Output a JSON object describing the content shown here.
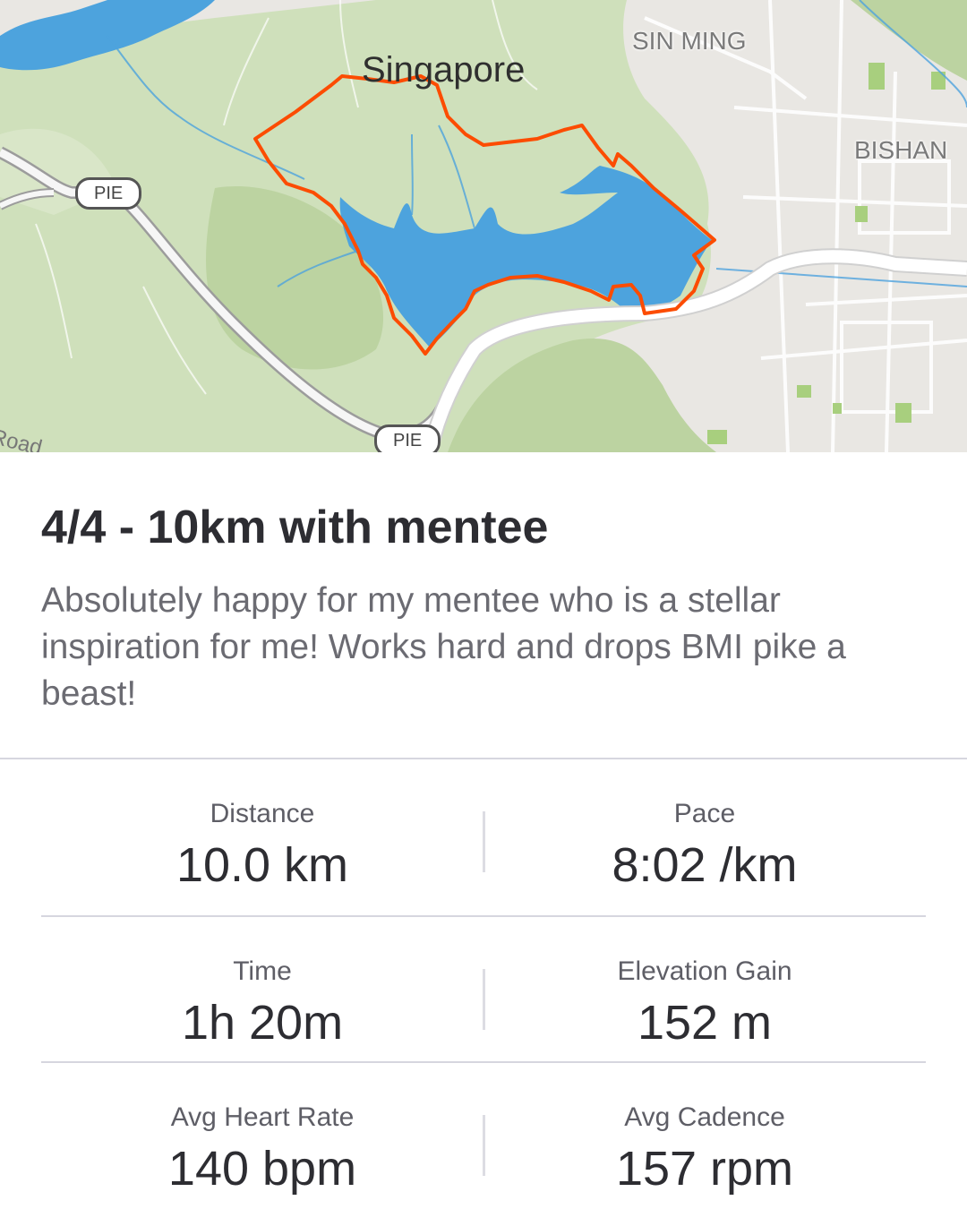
{
  "map": {
    "city_label": "Singapore",
    "area_labels": [
      "SIN MING",
      "BISHAN"
    ],
    "road_shields": [
      "PIE",
      "PIE"
    ],
    "road_label": "Road",
    "colors": {
      "route": "#fc4c02",
      "water": "#4da3dd",
      "park": "#c7dbb0",
      "land": "#e9e7e3",
      "road": "#ffffff",
      "highway_casing": "#9c9c9c"
    }
  },
  "activity": {
    "title": "4/4 - 10km with mentee",
    "description": "Absolutely happy for my mentee who is a stellar inspiration for me! Works hard and drops BMI pike a beast!"
  },
  "stats": [
    {
      "left": {
        "label": "Distance",
        "value": "10.0 km"
      },
      "right": {
        "label": "Pace",
        "value": "8:02 /km"
      }
    },
    {
      "left": {
        "label": "Time",
        "value": "1h 20m"
      },
      "right": {
        "label": "Elevation Gain",
        "value": "152 m"
      }
    },
    {
      "left": {
        "label": "Avg Heart Rate",
        "value": "140 bpm"
      },
      "right": {
        "label": "Avg Cadence",
        "value": "157 rpm"
      }
    }
  ]
}
